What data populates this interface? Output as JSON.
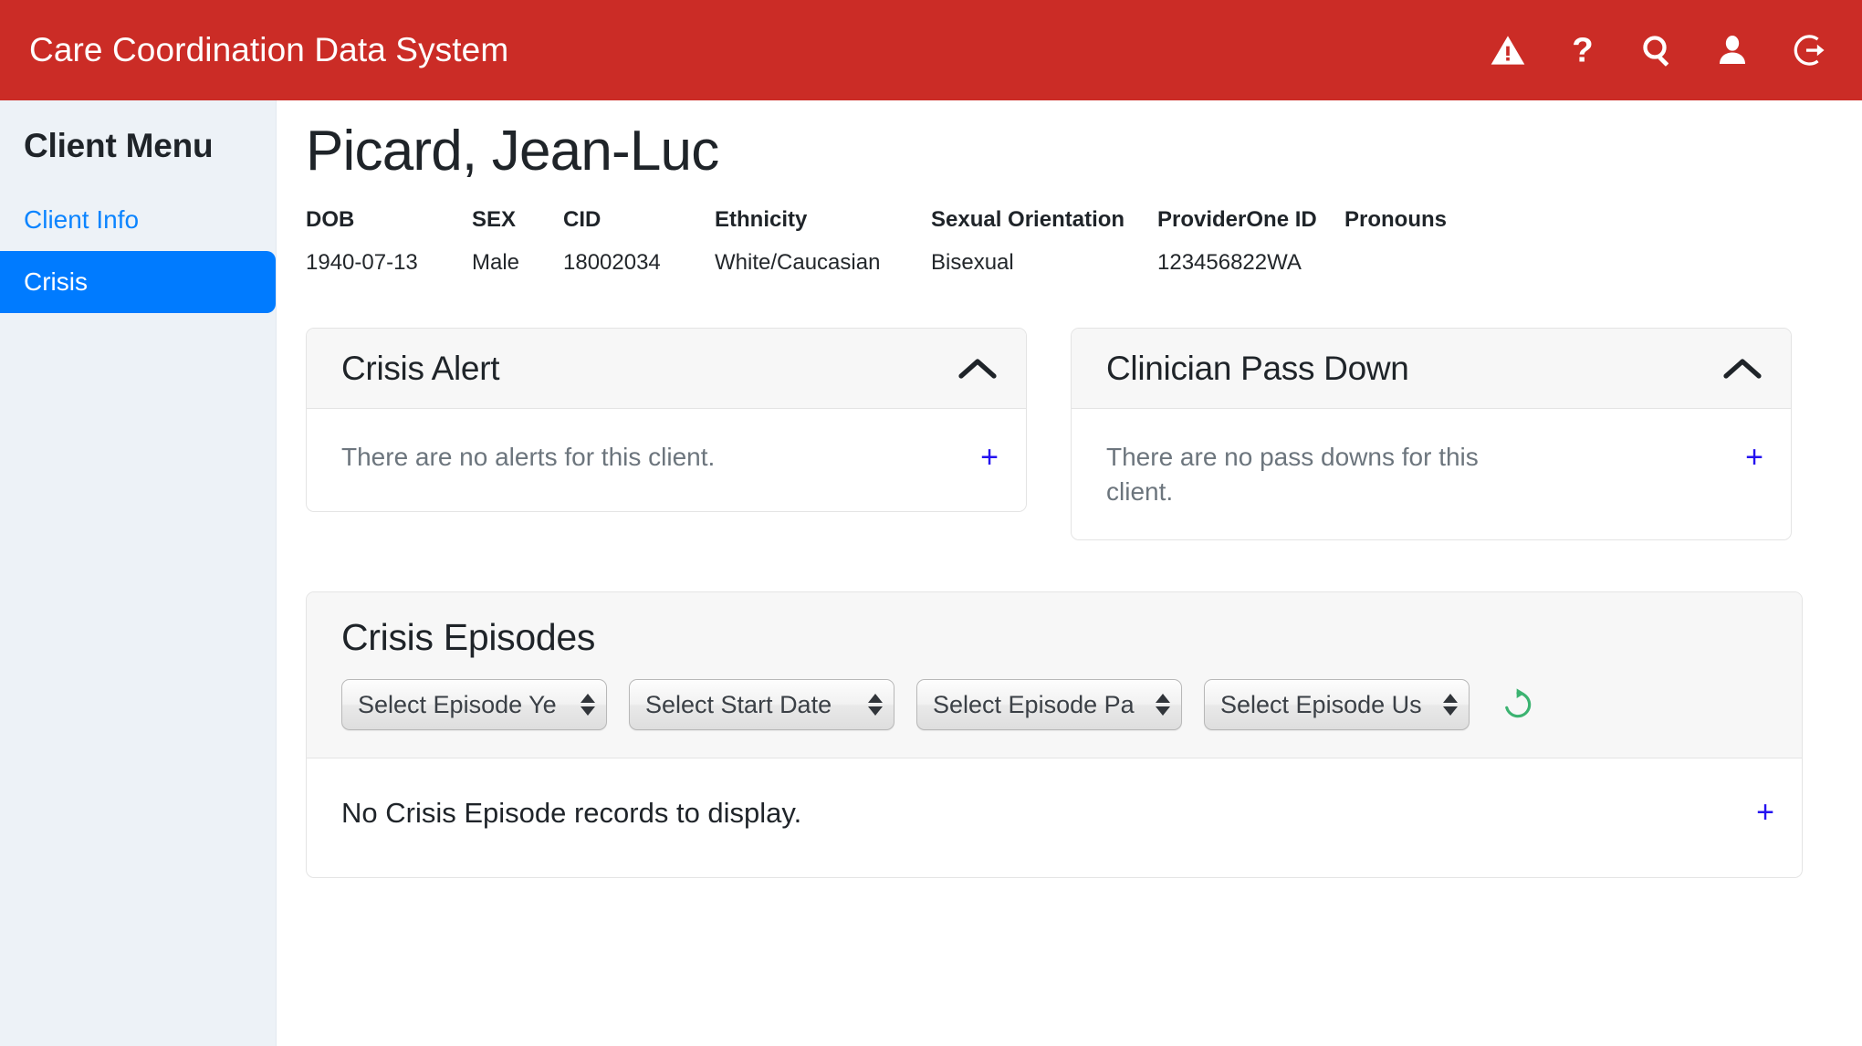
{
  "app": {
    "title": "Care Coordination Data System",
    "brand_color": "#cb2c26",
    "accent_color": "#007bff",
    "icons": [
      {
        "name": "warning-icon",
        "label": "Alerts"
      },
      {
        "name": "help-icon",
        "label": "Help"
      },
      {
        "name": "search-icon",
        "label": "Search"
      },
      {
        "name": "user-icon",
        "label": "User Profile"
      },
      {
        "name": "logout-icon",
        "label": "Log Out"
      }
    ]
  },
  "sidebar": {
    "title": "Client Menu",
    "items": [
      {
        "label": "Client Info",
        "active": false
      },
      {
        "label": "Crisis",
        "active": true
      }
    ]
  },
  "client": {
    "name": "Picard, Jean-Luc",
    "fields": [
      {
        "label": "DOB",
        "value": "1940-07-13"
      },
      {
        "label": "SEX",
        "value": "Male"
      },
      {
        "label": "CID",
        "value": "18002034"
      },
      {
        "label": "Ethnicity",
        "value": "White/Caucasian"
      },
      {
        "label": "Sexual Orientation",
        "value": "Bisexual"
      },
      {
        "label": "ProviderOne ID",
        "value": "123456822WA"
      },
      {
        "label": "Pronouns",
        "value": ""
      }
    ]
  },
  "cards": {
    "crisis_alert": {
      "title": "Crisis Alert",
      "empty_message": "There are no alerts for this client.",
      "add_label": "+",
      "collapse_icon": "chevron-up-icon"
    },
    "clinician_pass_down": {
      "title": "Clinician Pass Down",
      "empty_message": "There are no pass downs for this client.",
      "add_label": "+",
      "collapse_icon": "chevron-up-icon"
    }
  },
  "episodes": {
    "title": "Crisis Episodes",
    "filters": [
      {
        "name": "episode-year-select",
        "selected": "Select Episode Ye"
      },
      {
        "name": "start-date-select",
        "selected": "Select Start Date"
      },
      {
        "name": "episode-participant-select",
        "selected": "Select Episode Pa"
      },
      {
        "name": "episode-user-select",
        "selected": "Select Episode Us"
      }
    ],
    "refresh_icon": "refresh-icon",
    "empty_message": "No Crisis Episode records to display.",
    "add_label": "+"
  }
}
